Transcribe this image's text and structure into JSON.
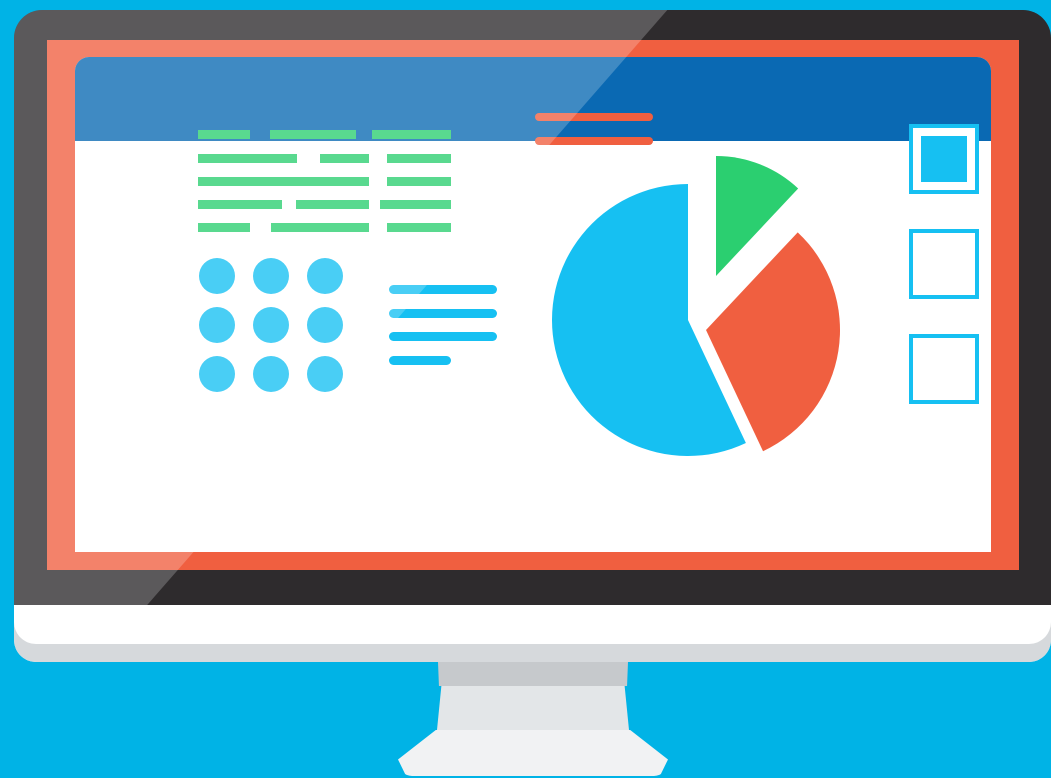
{
  "colors": {
    "background": "#00b3e6",
    "bezel": "#2e2b2d",
    "frame": "#f05f40",
    "screen": "#ffffff",
    "header": "#0a69b3",
    "green": "#2bcf70",
    "blue": "#16c0f2",
    "red": "#f05f40",
    "chin": "#ffffff",
    "stand": "#e3e6e8"
  },
  "icons": {
    "dot_grid": "circle-icon",
    "checkbox": "checkbox-icon"
  },
  "pie": {
    "slices": [
      {
        "name": "blue",
        "value": 57,
        "color": "#16c0f2",
        "exploded": false
      },
      {
        "name": "red",
        "value": 31,
        "color": "#f05f40",
        "exploded": true
      },
      {
        "name": "green",
        "value": 12,
        "color": "#2bcf70",
        "exploded": true
      }
    ]
  },
  "checkboxes": [
    {
      "checked": true
    },
    {
      "checked": false
    },
    {
      "checked": false
    }
  ]
}
